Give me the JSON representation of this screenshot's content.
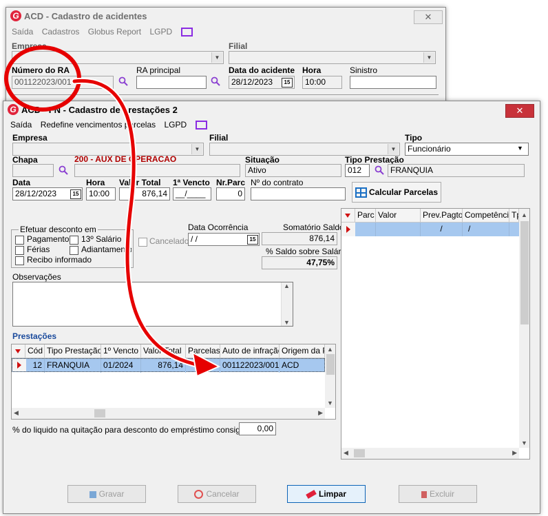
{
  "back_window": {
    "title": "ACD - Cadastro de acidentes",
    "close": "✕",
    "menu": [
      "Saída",
      "Cadastros",
      "Globus Report",
      "LGPD"
    ],
    "empresa_label": "Empresa",
    "filial_label": "Filial",
    "numero_ra_label": "Número do RA",
    "numero_ra_value": "001122023/001",
    "ra_principal_label": "RA principal",
    "data_acidente_label": "Data do acidente",
    "data_acidente_value": "28/12/2023",
    "hora_label": "Hora",
    "hora_value": "10:00",
    "sinistro_label": "Sinistro"
  },
  "front_window": {
    "title": "ACD - FN - Cadastro de prestações 2",
    "close": "✕",
    "menu": [
      "Saída",
      "Redefine vencimentos parcelas",
      "LGPD"
    ],
    "empresa_label": "Empresa",
    "filial_label": "Filial",
    "tipo_label": "Tipo",
    "tipo_value": "Funcionário",
    "chapa_label": "Chapa",
    "cargo_value": "200 - AUX DE OPERACAO",
    "situacao_label": "Situação",
    "situacao_value": "Ativo",
    "tipo_prestacao_label": "Tipo Prestação",
    "tipo_prestacao_code": "012",
    "tipo_prestacao_name": "FRANQUIA",
    "data_label": "Data",
    "data_value": "28/12/2023",
    "hora_label": "Hora",
    "hora_value": "10:00",
    "valor_total_label": "Valor Total",
    "valor_total_value": "876,14",
    "primeiro_vencto_label": "1ª Vencto",
    "primeiro_vencto_value": "__/____",
    "nr_parc_label": "Nr.Parc",
    "nr_parc_value": "0",
    "contrato_label": "Nº do contrato",
    "calcular_label": "Calcular Parcelas",
    "desconto_group_label": "Efetuar desconto em",
    "desconto_options": [
      "Pagamento",
      "13º Salário",
      "Férias",
      "Adiantamento",
      "Recibo informado"
    ],
    "cancelado_label": "Cancelado",
    "data_ocorrencia_label": "Data Ocorrência",
    "data_ocorrencia_value": " / /",
    "somatorio_label": "Somatório Saldo",
    "somatorio_value": "876,14",
    "saldo_pct_label": "% Saldo sobre Salário",
    "saldo_pct_value": "47,75%",
    "observacoes_label": "Observações",
    "prestacoes_label": "Prestações",
    "prestacoes_columns": [
      "Cód",
      "Tipo Prestação",
      "1º Vencto",
      "Valor Total",
      "Parcelas",
      "Auto de infração",
      "Origem da Pr"
    ],
    "prestacoes_rows": [
      {
        "cod": "12",
        "tipo": "FRANQUIA",
        "vencto": "01/2024",
        "valor": "876,14",
        "parcelas": "",
        "auto": "001122023/001",
        "origem": "ACD"
      }
    ],
    "parcelas_columns": [
      "Parc",
      "Valor",
      "Prev.Pagto",
      "Competência",
      "Tp"
    ],
    "parcelas_row": {
      "parc": "",
      "valor": "",
      "prev": "/",
      "comp": "/"
    },
    "consignado_label": "% do liquido na quitação para desconto do empréstimo consignado",
    "consignado_value": "0,00",
    "buttons": {
      "gravar": "Gravar",
      "cancelar": "Cancelar",
      "limpar": "Limpar",
      "excluir": "Excluir"
    }
  },
  "colors": {
    "highlight_row": "#a6c8ef",
    "accent_red": "#d01010",
    "title_red": "#b00000"
  }
}
